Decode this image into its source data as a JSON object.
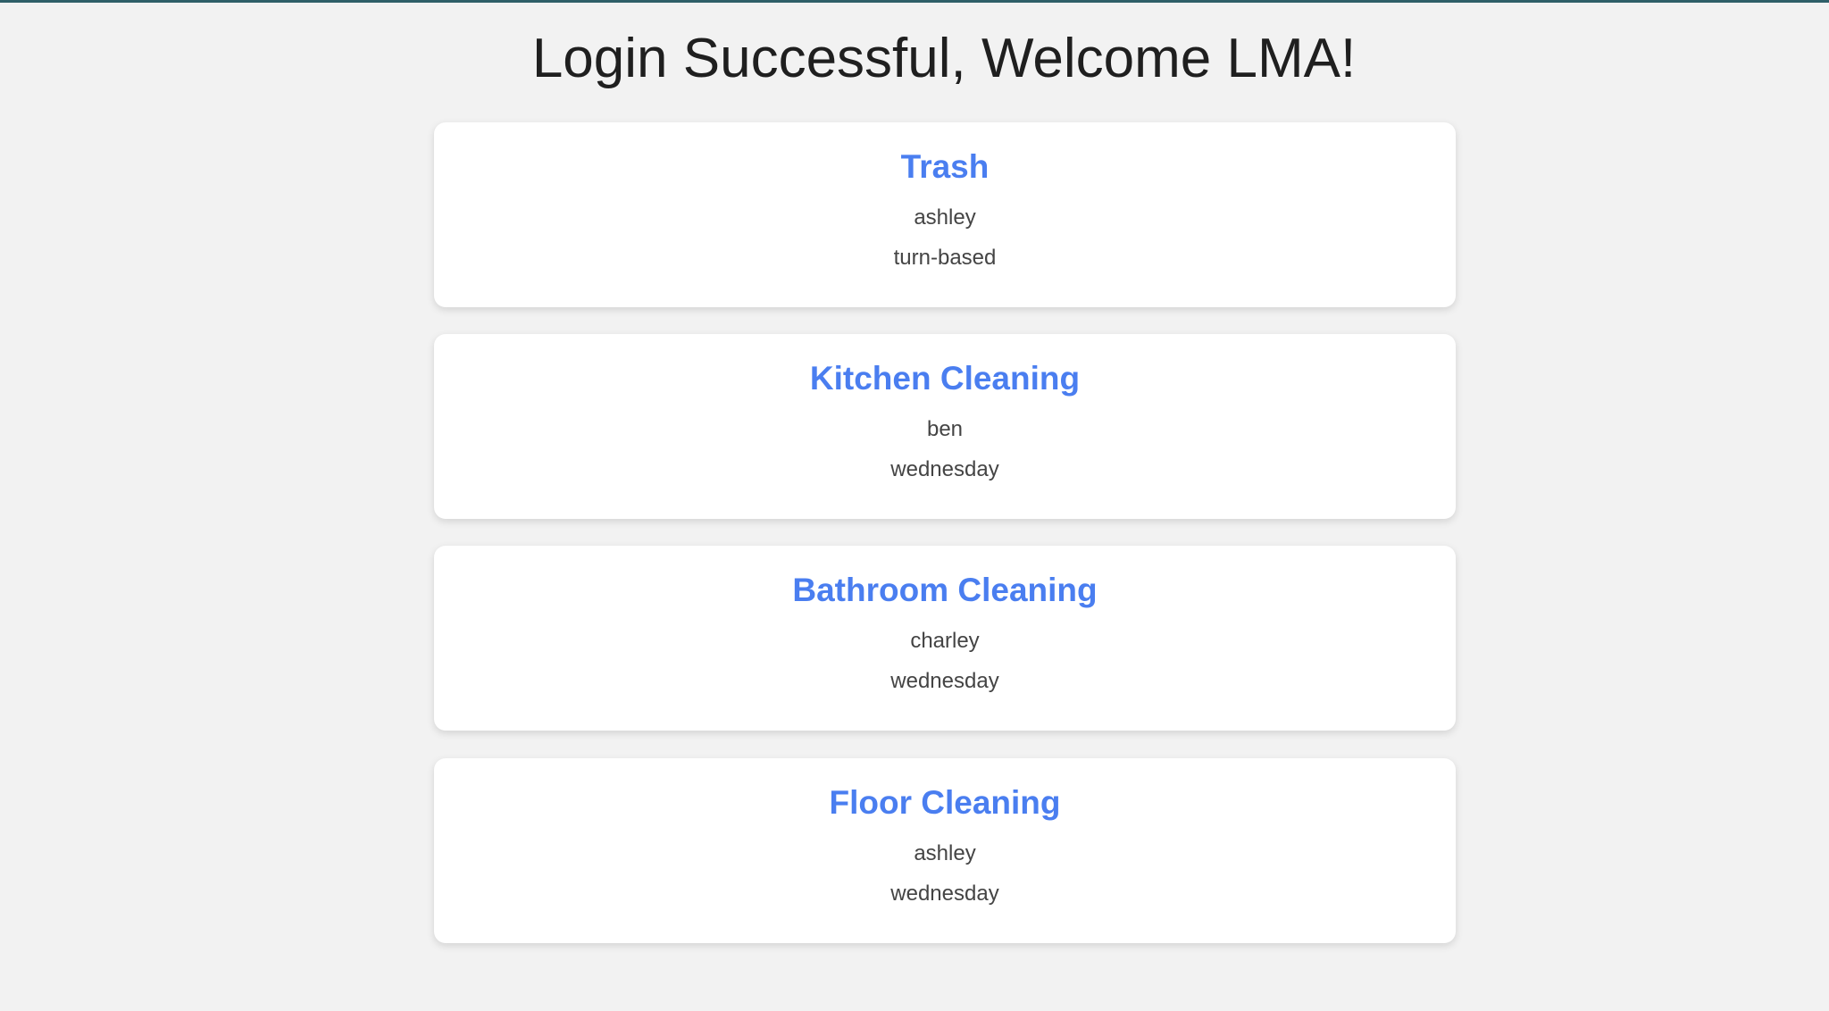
{
  "colors": {
    "background": "#f2f2f2",
    "top_bar": "#2f5f68",
    "title_text": "#1f1f1f",
    "card_title": "#4a7ef0",
    "card_text": "#444444",
    "card_background": "#ffffff"
  },
  "header": {
    "title": "Login Successful, Welcome LMA!"
  },
  "chores": [
    {
      "name": "Trash",
      "assignee": "ashley",
      "schedule": "turn-based"
    },
    {
      "name": "Kitchen Cleaning",
      "assignee": "ben",
      "schedule": "wednesday"
    },
    {
      "name": "Bathroom Cleaning",
      "assignee": "charley",
      "schedule": "wednesday"
    },
    {
      "name": "Floor Cleaning",
      "assignee": "ashley",
      "schedule": "wednesday"
    }
  ]
}
